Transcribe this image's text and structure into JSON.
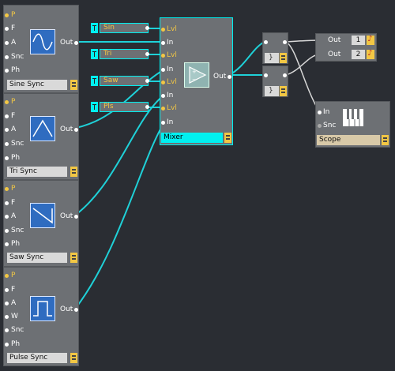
{
  "modules": {
    "sine": {
      "title": "Sine Sync",
      "inputs": [
        "P",
        "F",
        "A",
        "Snc",
        "Ph"
      ],
      "output": "Out"
    },
    "tri": {
      "title": "Tri Sync",
      "inputs": [
        "P",
        "F",
        "A",
        "Snc",
        "Ph"
      ],
      "output": "Out"
    },
    "saw": {
      "title": "Saw Sync",
      "inputs": [
        "P",
        "F",
        "A",
        "Snc",
        "Ph"
      ],
      "output": "Out"
    },
    "pulse": {
      "title": "Pulse Sync",
      "inputs": [
        "P",
        "F",
        "A",
        "W",
        "Snc",
        "Ph"
      ],
      "output": "Out"
    }
  },
  "constants": [
    {
      "label": "Sin"
    },
    {
      "label": "Tri"
    },
    {
      "label": "Saw"
    },
    {
      "label": "Pls"
    }
  ],
  "mixer": {
    "title": "Mixer",
    "inputs": [
      "Lvl",
      "In",
      "Lvl",
      "In",
      "Lvl",
      "In",
      "Lvl",
      "In"
    ],
    "output": "Out"
  },
  "outputs": [
    {
      "label": "Out",
      "channel": "1"
    },
    {
      "label": "Out",
      "channel": "2"
    }
  ],
  "scope": {
    "title": "Scope",
    "inputs": [
      "In",
      "Snc"
    ]
  },
  "colors": {
    "wire": "#1fd1d8",
    "cable_white": "#d8d8d8",
    "accent": "#f2c744",
    "selected": "#00f0f0"
  },
  "icons": {
    "sine": "sine-wave-icon",
    "tri": "triangle-wave-icon",
    "saw": "saw-wave-icon",
    "pulse": "pulse-wave-icon",
    "mixer": "amplifier-icon",
    "scope": "piano-keys-icon"
  }
}
